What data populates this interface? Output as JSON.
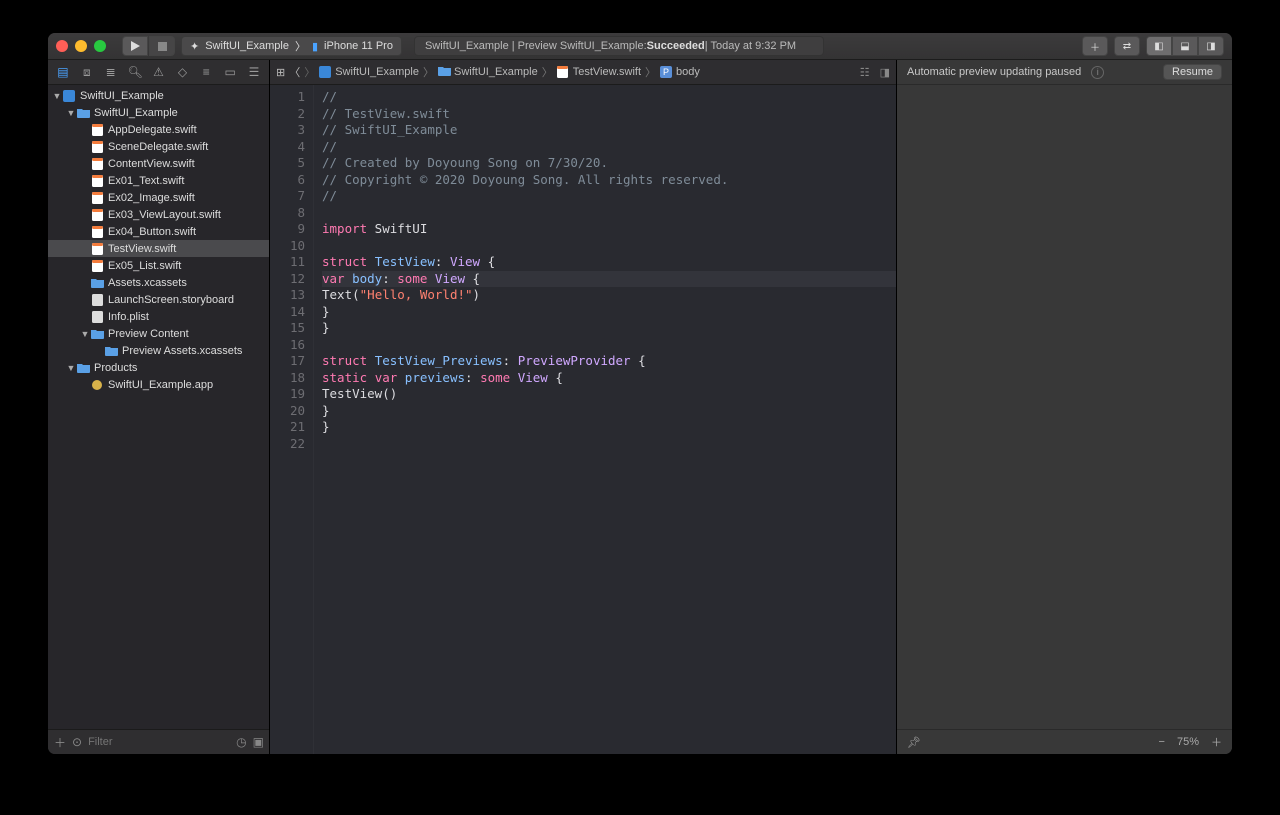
{
  "toolbar": {
    "scheme": {
      "target": "SwiftUI_Example",
      "device": "iPhone 11 Pro"
    },
    "status": {
      "prefix": "SwiftUI_Example | Preview SwiftUI_Example: ",
      "result": "Succeeded",
      "suffix": " | Today at 9:32 PM"
    }
  },
  "navigator": {
    "filter_placeholder": "Filter",
    "tree": [
      {
        "d": 0,
        "icon": "blue",
        "open": true,
        "label": "SwiftUI_Example"
      },
      {
        "d": 1,
        "icon": "folder",
        "open": true,
        "label": "SwiftUI_Example"
      },
      {
        "d": 2,
        "icon": "swift",
        "label": "AppDelegate.swift"
      },
      {
        "d": 2,
        "icon": "swift",
        "label": "SceneDelegate.swift"
      },
      {
        "d": 2,
        "icon": "swift",
        "label": "ContentView.swift"
      },
      {
        "d": 2,
        "icon": "swift",
        "label": "Ex01_Text.swift"
      },
      {
        "d": 2,
        "icon": "swift",
        "label": "Ex02_Image.swift"
      },
      {
        "d": 2,
        "icon": "swift",
        "label": "Ex03_ViewLayout.swift"
      },
      {
        "d": 2,
        "icon": "swift",
        "label": "Ex04_Button.swift"
      },
      {
        "d": 2,
        "icon": "swift",
        "label": "TestView.swift",
        "sel": true
      },
      {
        "d": 2,
        "icon": "swift",
        "label": "Ex05_List.swift"
      },
      {
        "d": 2,
        "icon": "asset",
        "label": "Assets.xcassets"
      },
      {
        "d": 2,
        "icon": "sb",
        "label": "LaunchScreen.storyboard"
      },
      {
        "d": 2,
        "icon": "plist",
        "label": "Info.plist"
      },
      {
        "d": 2,
        "icon": "folder",
        "open": true,
        "label": "Preview Content"
      },
      {
        "d": 3,
        "icon": "asset",
        "label": "Preview Assets.xcassets"
      },
      {
        "d": 1,
        "icon": "folder",
        "open": true,
        "label": "Products"
      },
      {
        "d": 2,
        "icon": "app",
        "label": "SwiftUI_Example.app"
      }
    ]
  },
  "jumpbar": {
    "crumbs": [
      {
        "icon": "blue",
        "label": "SwiftUI_Example"
      },
      {
        "icon": "folder",
        "label": "SwiftUI_Example"
      },
      {
        "icon": "swift",
        "label": "TestView.swift"
      },
      {
        "icon": "prop",
        "label": "body"
      }
    ]
  },
  "code": {
    "highlight_line": 12,
    "lines": [
      {
        "n": 1,
        "seg": [
          {
            "c": "c-cmt",
            "t": "//"
          }
        ]
      },
      {
        "n": 2,
        "seg": [
          {
            "c": "c-cmt",
            "t": "//  TestView.swift"
          }
        ]
      },
      {
        "n": 3,
        "seg": [
          {
            "c": "c-cmt",
            "t": "//  SwiftUI_Example"
          }
        ]
      },
      {
        "n": 4,
        "seg": [
          {
            "c": "c-cmt",
            "t": "//"
          }
        ]
      },
      {
        "n": 5,
        "seg": [
          {
            "c": "c-cmt",
            "t": "//  Created by Doyoung Song on 7/30/20."
          }
        ]
      },
      {
        "n": 6,
        "seg": [
          {
            "c": "c-cmt",
            "t": "//  Copyright © 2020 Doyoung Song. All rights reserved."
          }
        ]
      },
      {
        "n": 7,
        "seg": [
          {
            "c": "c-cmt",
            "t": "//"
          }
        ]
      },
      {
        "n": 8,
        "seg": [
          {
            "c": "c-plain",
            "t": ""
          }
        ]
      },
      {
        "n": 9,
        "seg": [
          {
            "c": "c-kw",
            "t": "import"
          },
          {
            "c": "c-plain",
            "t": " SwiftUI"
          }
        ]
      },
      {
        "n": 10,
        "seg": [
          {
            "c": "c-plain",
            "t": ""
          }
        ]
      },
      {
        "n": 11,
        "seg": [
          {
            "c": "c-kw",
            "t": "struct"
          },
          {
            "c": "c-plain",
            "t": " "
          },
          {
            "c": "c-prop",
            "t": "TestView"
          },
          {
            "c": "c-plain",
            "t": ": "
          },
          {
            "c": "c-type",
            "t": "View"
          },
          {
            "c": "c-plain",
            "t": " {"
          }
        ]
      },
      {
        "n": 12,
        "seg": [
          {
            "c": "c-plain",
            "t": "    "
          },
          {
            "c": "c-kw",
            "t": "var"
          },
          {
            "c": "c-plain",
            "t": " "
          },
          {
            "c": "c-prop",
            "t": "body"
          },
          {
            "c": "c-plain",
            "t": ": "
          },
          {
            "c": "c-kw",
            "t": "some"
          },
          {
            "c": "c-plain",
            "t": " "
          },
          {
            "c": "c-type",
            "t": "View"
          },
          {
            "c": "c-plain",
            "t": " {"
          }
        ]
      },
      {
        "n": 13,
        "seg": [
          {
            "c": "c-plain",
            "t": "        Text("
          },
          {
            "c": "c-str",
            "t": "\"Hello, World!\""
          },
          {
            "c": "c-plain",
            "t": ")"
          }
        ]
      },
      {
        "n": 14,
        "seg": [
          {
            "c": "c-plain",
            "t": "    }"
          }
        ]
      },
      {
        "n": 15,
        "seg": [
          {
            "c": "c-plain",
            "t": "}"
          }
        ]
      },
      {
        "n": 16,
        "seg": [
          {
            "c": "c-plain",
            "t": ""
          }
        ]
      },
      {
        "n": 17,
        "seg": [
          {
            "c": "c-kw",
            "t": "struct"
          },
          {
            "c": "c-plain",
            "t": " "
          },
          {
            "c": "c-prop",
            "t": "TestView_Previews"
          },
          {
            "c": "c-plain",
            "t": ": "
          },
          {
            "c": "c-type",
            "t": "PreviewProvider"
          },
          {
            "c": "c-plain",
            "t": " {"
          }
        ]
      },
      {
        "n": 18,
        "seg": [
          {
            "c": "c-plain",
            "t": "    "
          },
          {
            "c": "c-kw",
            "t": "static"
          },
          {
            "c": "c-plain",
            "t": " "
          },
          {
            "c": "c-kw",
            "t": "var"
          },
          {
            "c": "c-plain",
            "t": " "
          },
          {
            "c": "c-prop",
            "t": "previews"
          },
          {
            "c": "c-plain",
            "t": ": "
          },
          {
            "c": "c-kw",
            "t": "some"
          },
          {
            "c": "c-plain",
            "t": " "
          },
          {
            "c": "c-type",
            "t": "View"
          },
          {
            "c": "c-plain",
            "t": " {"
          }
        ]
      },
      {
        "n": 19,
        "seg": [
          {
            "c": "c-plain",
            "t": "        TestView()"
          }
        ]
      },
      {
        "n": 20,
        "seg": [
          {
            "c": "c-plain",
            "t": "    }"
          }
        ]
      },
      {
        "n": 21,
        "seg": [
          {
            "c": "c-plain",
            "t": "}"
          }
        ]
      },
      {
        "n": 22,
        "seg": [
          {
            "c": "c-plain",
            "t": ""
          }
        ]
      }
    ]
  },
  "preview": {
    "status": "Automatic preview updating paused",
    "resume": "Resume",
    "zoom": "75%"
  }
}
